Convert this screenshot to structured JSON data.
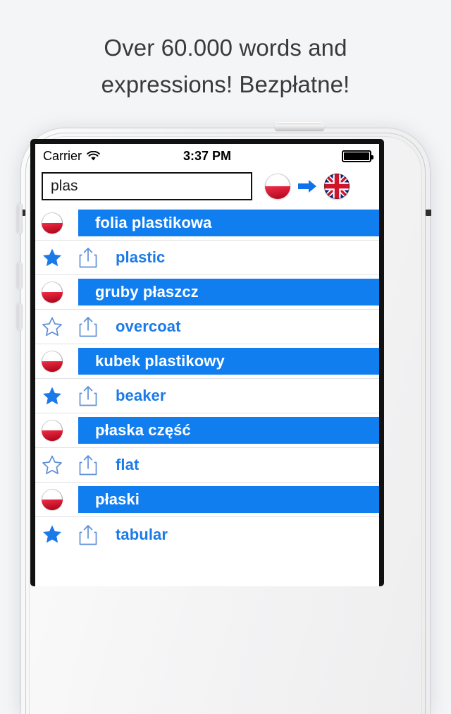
{
  "promo": {
    "line1": "Over 60.000 words and",
    "line2": "expressions! Bezpłatne!"
  },
  "colors": {
    "page_background": "#f4f5f7",
    "accent_blue": "#117ef0",
    "word_blue": "#1b7ae8",
    "headline_text": "#3a3a3c",
    "flag_red": "#e8112d"
  },
  "device": {
    "hardware": {
      "power_button": "power-button",
      "mute_switch": "mute-switch",
      "volume_up": "volume-up-button",
      "volume_down": "volume-down-button",
      "earpiece": "earpiece-speaker",
      "front_camera": "front-camera",
      "proximity_sensor": "proximity-sensor"
    }
  },
  "status_bar": {
    "carrier": "Carrier",
    "wifi_icon": "wifi-icon",
    "time": "3:37 PM",
    "battery_icon": "battery-full-icon"
  },
  "search": {
    "value": "plas",
    "placeholder": "",
    "source_flag": "poland-flag-icon",
    "direction_icon": "right-arrow-icon",
    "target_flag": "united-kingdom-flag-icon"
  },
  "results": [
    {
      "type": "source",
      "lang": "pl",
      "text": "folia plastikowa",
      "flag_icon": "poland-flag-icon"
    },
    {
      "type": "translation",
      "lang": "en",
      "text": "plastic",
      "starred": true,
      "star_icon": "star-filled-icon",
      "share_icon": "share-icon"
    },
    {
      "type": "source",
      "lang": "pl",
      "text": "gruby płaszcz",
      "flag_icon": "poland-flag-icon"
    },
    {
      "type": "translation",
      "lang": "en",
      "text": "overcoat",
      "starred": false,
      "star_icon": "star-outline-icon",
      "share_icon": "share-icon"
    },
    {
      "type": "source",
      "lang": "pl",
      "text": "kubek plastikowy",
      "flag_icon": "poland-flag-icon"
    },
    {
      "type": "translation",
      "lang": "en",
      "text": "beaker",
      "starred": true,
      "star_icon": "star-filled-icon",
      "share_icon": "share-icon"
    },
    {
      "type": "source",
      "lang": "pl",
      "text": "płaska część",
      "flag_icon": "poland-flag-icon"
    },
    {
      "type": "translation",
      "lang": "en",
      "text": "flat",
      "starred": false,
      "star_icon": "star-outline-icon",
      "share_icon": "share-icon"
    },
    {
      "type": "source",
      "lang": "pl",
      "text": "płaski",
      "flag_icon": "poland-flag-icon"
    },
    {
      "type": "translation",
      "lang": "en",
      "text": "tabular",
      "starred": true,
      "star_icon": "star-filled-icon",
      "share_icon": "share-icon"
    }
  ]
}
